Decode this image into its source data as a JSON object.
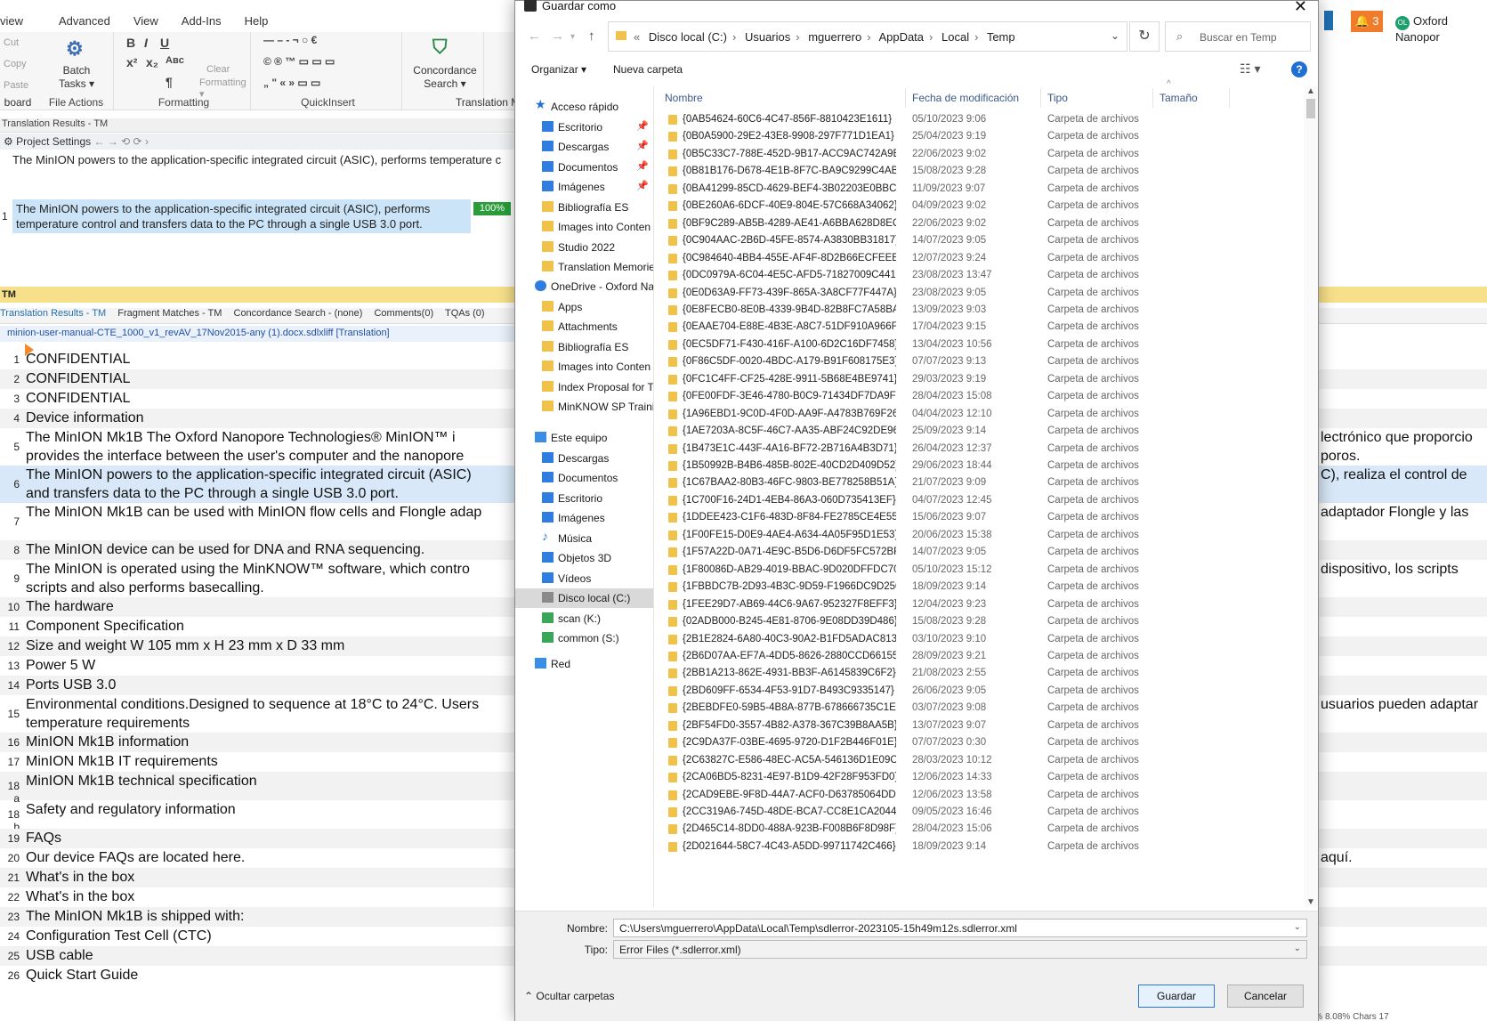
{
  "app": {
    "menu": [
      "view",
      "Advanced",
      "View",
      "Add-Ins",
      "Help"
    ],
    "ribbon": {
      "clipboard": {
        "cut": "Cut",
        "copy": "Copy",
        "paste": "Paste",
        "label": "board"
      },
      "file_actions": {
        "batch": "Batch",
        "tasks": "Tasks ▾",
        "label": "File Actions"
      },
      "formatting": {
        "clear": "Clear",
        "clear2": "Formatting ▾",
        "label": "Formatting"
      },
      "quickinsert": {
        "label": "QuickInsert"
      },
      "concordance": {
        "l1": "Concordance",
        "l2": "Search ▾"
      },
      "translation_memory": {
        "label": "Translation M"
      }
    },
    "results_header": "Translation Results - TM",
    "project_settings": "Project Settings",
    "tm_source": "The MinION powers to the application-specific integrated circuit (ASIC), performs temperature c",
    "tm_match": {
      "num": "1",
      "text": "The MinION powers to the application-specific integrated circuit (ASIC), performs temperature control and transfers data to the PC through a single USB 3.0 port.",
      "percent": "100%"
    },
    "tm_bar": "TM",
    "tabs": [
      "Translation Results - TM",
      "Fragment Matches - TM",
      "Concordance Search - (none)",
      "Comments(0)",
      "TQAs (0)"
    ],
    "doc_tab": "minion-user-manual-CTE_1000_v1_revAV_17Nov2015-any (1).docx.sdlxliff [Translation]",
    "notif_count": "3",
    "org_name": "Oxford Nanopor",
    "org_badge": "OL",
    "status": "All segments  INS  82%  80.50%  8.08%  Chars 17",
    "segments": [
      {
        "n": "1",
        "src": "CONFIDENTIAL",
        "src2": "",
        "tgt": "",
        "tgt2": ""
      },
      {
        "n": "2",
        "src": "CONFIDENTIAL",
        "src2": "",
        "tgt": "",
        "tgt2": ""
      },
      {
        "n": "3",
        "src": "CONFIDENTIAL",
        "src2": "",
        "tgt": "",
        "tgt2": ""
      },
      {
        "n": "4",
        "src": "Device information",
        "src2": "",
        "tgt": "",
        "tgt2": ""
      },
      {
        "n": "5",
        "src": "The MinION Mk1B The Oxford Nanopore Technologies® MinION™ i",
        "src2": "provides the interface between the user's computer and the nanopore",
        "tgt": "lectrónico que proporcio",
        "tgt2": "poros."
      },
      {
        "n": "6",
        "src": "The MinION powers to the application-specific integrated circuit (ASIC)",
        "src2": "and transfers data to the PC through a single USB 3.0 port.",
        "tgt": "C), realiza el control de",
        "tgt2": ""
      },
      {
        "n": "7",
        "src": "The MinION Mk1B can be used with MinION flow cells and Flongle adap",
        "src2": "",
        "tgt": "adaptador Flongle y las",
        "tgt2": ""
      },
      {
        "n": "8",
        "src": "The MinION device can be used for DNA and RNA sequencing.",
        "src2": "",
        "tgt": "",
        "tgt2": ""
      },
      {
        "n": "9",
        "src": "The MinION is operated using the MinKNOW™ software, which contro",
        "src2": "scripts and also performs basecalling.",
        "tgt": "dispositivo, los scripts",
        "tgt2": ""
      },
      {
        "n": "10",
        "src": "The hardware",
        "src2": "",
        "tgt": "",
        "tgt2": ""
      },
      {
        "n": "11",
        "src": "Component Specification",
        "src2": "",
        "tgt": "",
        "tgt2": ""
      },
      {
        "n": "12",
        "src": "Size and weight W 105 mm x H 23 mm x D 33 mm",
        "src2": "",
        "tgt": "",
        "tgt2": ""
      },
      {
        "n": "13",
        "src": "Power 5 W",
        "src2": "",
        "tgt": "",
        "tgt2": ""
      },
      {
        "n": "14",
        "src": "Ports USB 3.0",
        "src2": "",
        "tgt": "",
        "tgt2": ""
      },
      {
        "n": "15",
        "src": "Environmental conditions.Designed to sequence at 18°C to 24°C. Users",
        "src2": "temperature requirements",
        "tgt": "usuarios pueden adaptar",
        "tgt2": ""
      },
      {
        "n": "16",
        "src": "MinION Mk1B information",
        "src2": "",
        "tgt": "",
        "tgt2": ""
      },
      {
        "n": "17",
        "src": "MinION Mk1B IT requirements",
        "src2": "",
        "tgt": "",
        "tgt2": ""
      },
      {
        "n": "18 a",
        "src": "MinION Mk1B technical specification",
        "src2": "",
        "tgt": "",
        "tgt2": ""
      },
      {
        "n": "18 b",
        "src": "Safety and regulatory information",
        "src2": "",
        "tgt": "",
        "tgt2": ""
      },
      {
        "n": "19",
        "src": "FAQs",
        "src2": "",
        "tgt": "",
        "tgt2": ""
      },
      {
        "n": "20",
        "src": "Our device FAQs are located here.",
        "src2": "",
        "tgt": "aquí.",
        "tgt2": ""
      },
      {
        "n": "21",
        "src": "What's in the box",
        "src2": "",
        "tgt": "",
        "tgt2": ""
      },
      {
        "n": "22",
        "src": "What's in the box",
        "src2": "",
        "tgt": "",
        "tgt2": ""
      },
      {
        "n": "23",
        "src": "The MinION Mk1B is shipped with:",
        "src2": "",
        "tgt": "",
        "tgt2": ""
      },
      {
        "n": "24",
        "src": "Configuration Test Cell (CTC)",
        "src2": "",
        "tgt": "",
        "tgt2": ""
      },
      {
        "n": "25",
        "src": "USB cable",
        "src2": "",
        "tgt": "",
        "tgt2": ""
      },
      {
        "n": "26",
        "src": "Quick Start Guide",
        "src2": "",
        "tgt": "",
        "tgt2": ""
      }
    ]
  },
  "dialog": {
    "title": "Guardar como",
    "breadcrumb": [
      "Disco local (C:)",
      "Usuarios",
      "mguerrero",
      "AppData",
      "Local",
      "Temp"
    ],
    "search_placeholder": "Buscar en Temp",
    "organize": "Organizar ▾",
    "new_folder": "Nueva carpeta",
    "columns": {
      "name": "Nombre",
      "date": "Fecha de modificación",
      "type": "Tipo",
      "size": "Tamaño"
    },
    "nav": [
      {
        "label": "Acceso rápido",
        "icon": "star-icon"
      },
      {
        "label": "Escritorio",
        "icon": "desktop-icon",
        "pin": true
      },
      {
        "label": "Descargas",
        "icon": "download-icon",
        "pin": true
      },
      {
        "label": "Documentos",
        "icon": "documents-icon",
        "pin": true
      },
      {
        "label": "Imágenes",
        "icon": "pictures-icon",
        "pin": true
      },
      {
        "label": "Bibliografía ES",
        "icon": "folder-icon"
      },
      {
        "label": "Images into Conten",
        "icon": "folder-icon"
      },
      {
        "label": "Studio 2022",
        "icon": "folder-icon"
      },
      {
        "label": "Translation Memorie",
        "icon": "folder-icon"
      },
      {
        "label": "OneDrive - Oxford Na",
        "icon": "cloud-icon"
      },
      {
        "label": "Apps",
        "icon": "folder-icon"
      },
      {
        "label": "Attachments",
        "icon": "folder-icon"
      },
      {
        "label": "Bibliografía ES",
        "icon": "folder-icon"
      },
      {
        "label": "Images into Conten",
        "icon": "folder-icon"
      },
      {
        "label": "Index Proposal for T",
        "icon": "folder-icon"
      },
      {
        "label": "MinKNOW SP Trainir",
        "icon": "folder-icon"
      },
      {
        "label": "Este equipo",
        "icon": "computer-icon"
      },
      {
        "label": "Descargas",
        "icon": "download-icon"
      },
      {
        "label": "Documentos",
        "icon": "documents-icon"
      },
      {
        "label": "Escritorio",
        "icon": "desktop-icon"
      },
      {
        "label": "Imágenes",
        "icon": "pictures-icon"
      },
      {
        "label": "Música",
        "icon": "music-icon"
      },
      {
        "label": "Objetos 3D",
        "icon": "3d-objects-icon"
      },
      {
        "label": "Vídeos",
        "icon": "videos-icon"
      },
      {
        "label": "Disco local (C:)",
        "icon": "drive-icon",
        "selected": true
      },
      {
        "label": "scan (K:)",
        "icon": "network-drive-icon"
      },
      {
        "label": "common (S:)",
        "icon": "network-drive-icon"
      },
      {
        "label": "Red",
        "icon": "network-icon"
      }
    ],
    "files": [
      {
        "name": "{0AB54624-60C6-4C47-856F-8810423E1611}",
        "date": "05/10/2023 9:06",
        "type": "Carpeta de archivos"
      },
      {
        "name": "{0B0A5900-29E2-43E8-9908-297F771D1EA1}",
        "date": "25/04/2023 9:19",
        "type": "Carpeta de archivos"
      },
      {
        "name": "{0B5C33C7-788E-452D-9B17-ACC9AC742A9E}",
        "date": "22/06/2023 9:02",
        "type": "Carpeta de archivos"
      },
      {
        "name": "{0B81B176-D678-4E1B-8F7C-BA9C9299C4AB}",
        "date": "15/08/2023 9:28",
        "type": "Carpeta de archivos"
      },
      {
        "name": "{0BA41299-85CD-4629-BEF4-3B02203E0BBC}",
        "date": "11/09/2023 9:07",
        "type": "Carpeta de archivos"
      },
      {
        "name": "{0BE260A6-6DCF-40E9-804E-57C668A34062}",
        "date": "04/09/2023 9:02",
        "type": "Carpeta de archivos"
      },
      {
        "name": "{0BF9C289-AB5B-4289-AE41-A6BBA628D8EC}",
        "date": "22/06/2023 9:02",
        "type": "Carpeta de archivos"
      },
      {
        "name": "{0C904AAC-2B6D-45FE-8574-A3830BB31817}",
        "date": "14/07/2023 9:05",
        "type": "Carpeta de archivos"
      },
      {
        "name": "{0C984640-4BB4-455E-AF4F-8D2B66ECFEEE}",
        "date": "12/07/2023 9:24",
        "type": "Carpeta de archivos"
      },
      {
        "name": "{0DC0979A-6C04-4E5C-AFD5-71827009C441}",
        "date": "23/08/2023 13:47",
        "type": "Carpeta de archivos"
      },
      {
        "name": "{0E0D63A9-FF73-439F-865A-3A8CF77F447A}",
        "date": "23/08/2023 9:05",
        "type": "Carpeta de archivos"
      },
      {
        "name": "{0E8FECB0-8E0B-4339-9B4D-82B8FC7A58BA}",
        "date": "13/09/2023 9:03",
        "type": "Carpeta de archivos"
      },
      {
        "name": "{0EAAE704-E88E-4B3E-A8C7-51DF910A966F}",
        "date": "17/04/2023 9:15",
        "type": "Carpeta de archivos"
      },
      {
        "name": "{0EC5DF71-F430-416F-A100-6D2C16DF7458}",
        "date": "13/04/2023 10:56",
        "type": "Carpeta de archivos"
      },
      {
        "name": "{0F86C5DF-0020-4BDC-A179-B91F608175E3}",
        "date": "07/07/2023 9:13",
        "type": "Carpeta de archivos"
      },
      {
        "name": "{0FC1C4FF-CF25-428E-9911-5B68E4BE9741}",
        "date": "29/03/2023 9:19",
        "type": "Carpeta de archivos"
      },
      {
        "name": "{0FE00FDF-3E46-4780-B0C9-71434DF7DA9F}",
        "date": "28/04/2023 15:08",
        "type": "Carpeta de archivos"
      },
      {
        "name": "{1A96EBD1-9C0D-4F0D-AA9F-A4783B769F26}",
        "date": "04/04/2023 12:10",
        "type": "Carpeta de archivos"
      },
      {
        "name": "{1AE7203A-8C5F-46C7-AA35-ABF24C92DE96}",
        "date": "25/09/2023 9:14",
        "type": "Carpeta de archivos"
      },
      {
        "name": "{1B473E1C-443F-4A16-BF72-2B716A4B3D71}",
        "date": "26/04/2023 12:37",
        "type": "Carpeta de archivos"
      },
      {
        "name": "{1B50992B-B4B6-485B-802E-40CD2D409D52}",
        "date": "29/06/2023 18:44",
        "type": "Carpeta de archivos"
      },
      {
        "name": "{1C67BAA2-80B3-46FC-9803-BE778258B51A}",
        "date": "21/07/2023 9:09",
        "type": "Carpeta de archivos"
      },
      {
        "name": "{1C700F16-24D1-4EB4-86A3-060D735413EF}",
        "date": "04/07/2023 12:45",
        "type": "Carpeta de archivos"
      },
      {
        "name": "{1DDEE423-C1F6-483D-8F84-FE2785CE4E55}",
        "date": "15/06/2023 9:07",
        "type": "Carpeta de archivos"
      },
      {
        "name": "{1F00FE15-D0E9-4AE4-A634-4A05F95D1E53}",
        "date": "20/06/2023 15:38",
        "type": "Carpeta de archivos"
      },
      {
        "name": "{1F57A22D-0A71-4E9C-B5D6-D6DF5FC572BF}",
        "date": "14/07/2023 9:05",
        "type": "Carpeta de archivos"
      },
      {
        "name": "{1F80086D-AB29-4019-BBAC-9D020DFFDC70}",
        "date": "05/10/2023 15:12",
        "type": "Carpeta de archivos"
      },
      {
        "name": "{1FBBDC7B-2D93-4B3C-9D59-F1966DC9D250}",
        "date": "18/09/2023 9:14",
        "type": "Carpeta de archivos"
      },
      {
        "name": "{1FEE29D7-AB69-44C6-9A67-952327F8EFF3}",
        "date": "12/04/2023 9:23",
        "type": "Carpeta de archivos"
      },
      {
        "name": "{02ADB000-B245-4E81-8706-9E08DD39D486}",
        "date": "15/08/2023 9:28",
        "type": "Carpeta de archivos"
      },
      {
        "name": "{2B1E2824-6A80-40C3-90A2-B1FD5ADAC813}",
        "date": "03/10/2023 9:10",
        "type": "Carpeta de archivos"
      },
      {
        "name": "{2B6D07AA-EF7A-4DD5-8626-2880CCD66155}",
        "date": "28/09/2023 9:21",
        "type": "Carpeta de archivos"
      },
      {
        "name": "{2BB1A213-862E-4931-BB3F-A6145839C6F2}",
        "date": "21/08/2023 2:55",
        "type": "Carpeta de archivos"
      },
      {
        "name": "{2BD609FF-6534-4F53-91D7-B493C9335147}",
        "date": "26/06/2023 9:05",
        "type": "Carpeta de archivos"
      },
      {
        "name": "{2BEBDFE0-59B5-4B8A-877B-678666735C1E}",
        "date": "03/07/2023 9:08",
        "type": "Carpeta de archivos"
      },
      {
        "name": "{2BF54FD0-3557-4B82-A378-367C39B8AA5B}",
        "date": "13/07/2023 9:07",
        "type": "Carpeta de archivos"
      },
      {
        "name": "{2C9DA37F-03BE-4695-9720-D1F2B446F01E}",
        "date": "07/07/2023 0:30",
        "type": "Carpeta de archivos"
      },
      {
        "name": "{2C63827C-E586-48EC-AC5A-546136D1E09C}",
        "date": "28/03/2023 10:12",
        "type": "Carpeta de archivos"
      },
      {
        "name": "{2CA06BD5-8231-4E97-B1D9-42F28F953FD0}",
        "date": "12/06/2023 14:33",
        "type": "Carpeta de archivos"
      },
      {
        "name": "{2CAD9EBE-9F8D-44A7-ACF0-D63785064DDA}",
        "date": "12/06/2023 13:58",
        "type": "Carpeta de archivos"
      },
      {
        "name": "{2CC319A6-745D-48DE-BCA7-CC8E1CA20445}",
        "date": "09/05/2023 16:46",
        "type": "Carpeta de archivos"
      },
      {
        "name": "{2D465C14-8DD0-488A-923B-F008B6F8D98F}",
        "date": "28/04/2023 15:06",
        "type": "Carpeta de archivos"
      },
      {
        "name": "{2D021644-58C7-4C43-A5DD-99711742C466}",
        "date": "18/09/2023 9:14",
        "type": "Carpeta de archivos"
      }
    ],
    "filename_label": "Nombre:",
    "filename": "C:\\Users\\mguerrero\\AppData\\Local\\Temp\\sdlerror-2023105-15h49m12s.sdlerror.xml",
    "type_label": "Tipo:",
    "type_value": "Error Files (*.sdlerror.xml)",
    "hide_folders": "Ocultar carpetas",
    "save": "Guardar",
    "cancel": "Cancelar"
  }
}
